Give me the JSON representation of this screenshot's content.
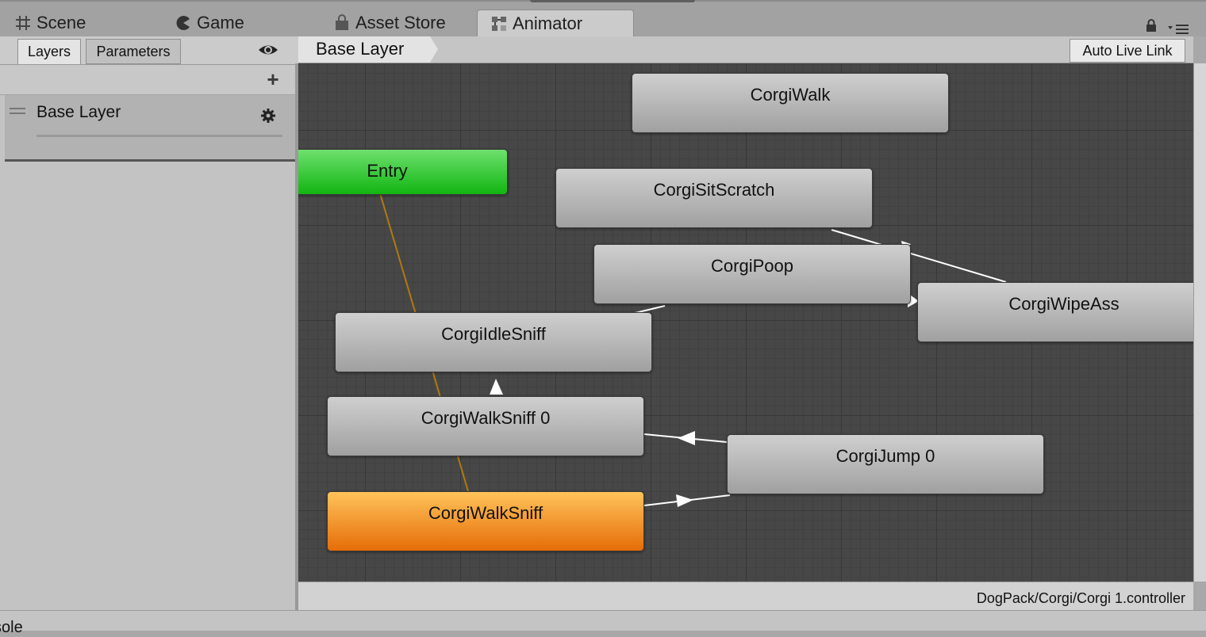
{
  "tabs": [
    {
      "label": "Scene",
      "icon": "grid-icon"
    },
    {
      "label": "Game",
      "icon": "pacman-icon"
    },
    {
      "label": "Asset Store",
      "icon": "shopping-bag-icon"
    },
    {
      "label": "Animator",
      "icon": "animator-icon",
      "active": true
    }
  ],
  "left_panel": {
    "tabs": {
      "layers": "Layers",
      "parameters": "Parameters"
    },
    "add_symbol": "+",
    "layers": [
      {
        "name": "Base Layer"
      }
    ]
  },
  "graph_header": {
    "breadcrumb": "Base Layer",
    "auto_live_link": "Auto Live Link"
  },
  "states": {
    "entry": "Entry",
    "walk": "CorgiWalk",
    "sit_scratch": "CorgiSitScratch",
    "poop": "CorgiPoop",
    "wipe_ass": "CorgiWipeAss",
    "idle_sniff": "CorgiIdleSniff",
    "walk_sniff_0": "CorgiWalkSniff 0",
    "jump_0": "CorgiJump 0",
    "walk_sniff": "CorgiWalkSniff"
  },
  "status_bar": {
    "path": "DogPack/Corgi/Corgi 1.controller"
  },
  "bottom_panel": {
    "label": "sole"
  },
  "colors": {
    "entry_state": "#11b511",
    "default_state": "#e66d08",
    "state": "#b4b4b4",
    "graph_bg": "#474747",
    "entry_transition": "#b07a10",
    "transition": "#ffffff"
  }
}
